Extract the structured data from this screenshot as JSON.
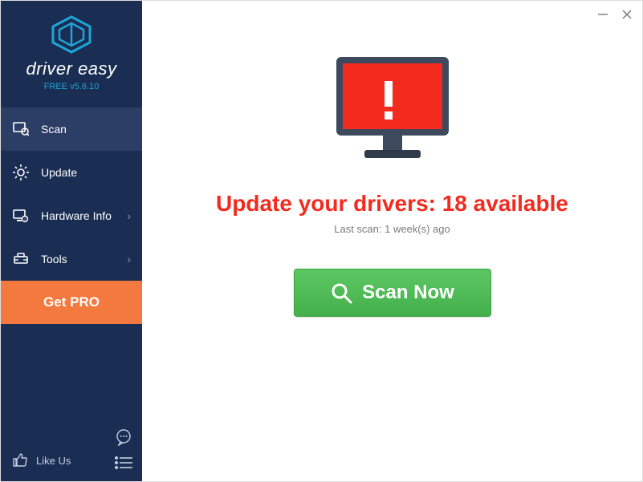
{
  "app": {
    "name": "driver easy",
    "version": "FREE v5.6.10"
  },
  "sidebar": {
    "items": [
      {
        "label": "Scan",
        "has_chevron": false
      },
      {
        "label": "Update",
        "has_chevron": false
      },
      {
        "label": "Hardware Info",
        "has_chevron": true
      },
      {
        "label": "Tools",
        "has_chevron": true
      }
    ],
    "get_pro_label": "Get PRO",
    "like_us_label": "Like Us"
  },
  "main": {
    "headline_prefix": "Update your drivers: ",
    "available_count": 18,
    "headline_suffix": " available",
    "last_scan": "Last scan: 1 week(s) ago",
    "scan_button": "Scan Now"
  }
}
